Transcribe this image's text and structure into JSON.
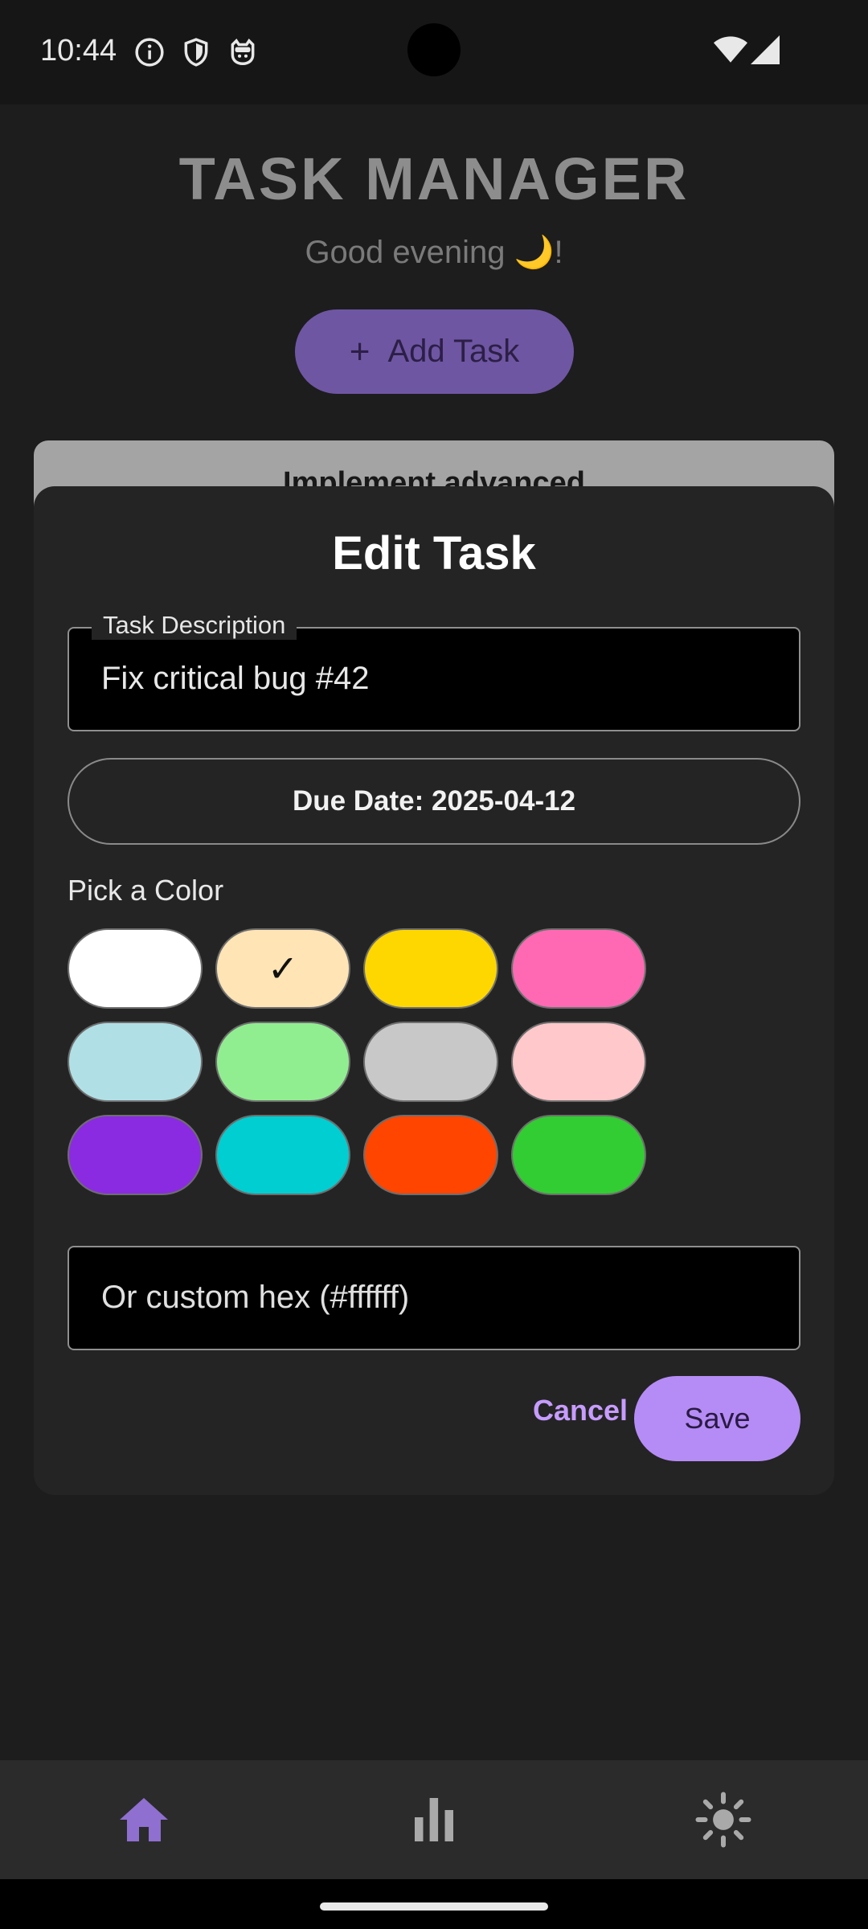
{
  "status_bar": {
    "time": "10:44",
    "icons": [
      "info-icon",
      "shield-icon",
      "cat-icon",
      "wifi-icon",
      "signal-icon"
    ]
  },
  "app": {
    "title": "TASK MANAGER",
    "greeting": "Good evening 🌙!",
    "add_task_label": "Add Task",
    "add_task_icon": "plus-icon",
    "background_task_title": "Implement advanced"
  },
  "dialog": {
    "title": "Edit Task",
    "task_description_label": "Task Description",
    "task_description_value": "Fix critical bug #42",
    "due_date_label": "Due Date: 2025-04-12",
    "pick_color_label": "Pick a Color",
    "selected_mark": "✓",
    "colors": [
      {
        "hex": "#ffffff",
        "selected": false
      },
      {
        "hex": "#ffe4b5",
        "selected": true
      },
      {
        "hex": "#ffd700",
        "selected": false
      },
      {
        "hex": "#ff69b4",
        "selected": false
      },
      {
        "hex": "#b0e0e6",
        "selected": false
      },
      {
        "hex": "#90ee90",
        "selected": false
      },
      {
        "hex": "#c8c8c8",
        "selected": false
      },
      {
        "hex": "#ffc8cb",
        "selected": false
      },
      {
        "hex": "#8a2be2",
        "selected": false
      },
      {
        "hex": "#00ced1",
        "selected": false
      },
      {
        "hex": "#ff4500",
        "selected": false
      },
      {
        "hex": "#32cd32",
        "selected": false
      }
    ],
    "custom_hex_placeholder": "Or custom hex (#ffffff)",
    "cancel_label": "Cancel",
    "save_label": "Save"
  },
  "bottom_nav": {
    "items": [
      {
        "icon": "home-icon",
        "active": true
      },
      {
        "icon": "bar-chart-icon",
        "active": false
      },
      {
        "icon": "sun-icon",
        "active": false
      }
    ],
    "active_color": "#8f6fd0",
    "inactive_color": "#a9a9a9"
  },
  "theme": {
    "accent": "#b58cf5",
    "accent_text": "#c79cff",
    "dialog_bg": "#242424"
  }
}
